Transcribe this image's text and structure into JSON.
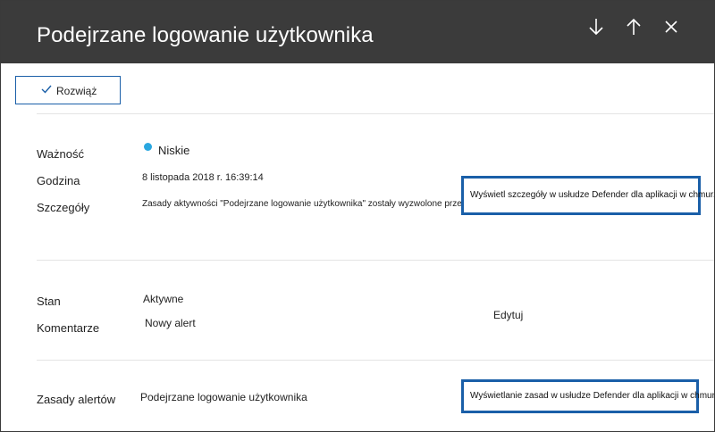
{
  "panel": {
    "title": "Podejrzane logowanie użytkownika",
    "resolve_label": "Rozwiąż"
  },
  "icons": {
    "down": "arrow-down-icon",
    "up": "arrow-up-icon",
    "close": "close-icon",
    "check": "checkmark-icon"
  },
  "details": {
    "severity_label": "Ważność",
    "severity_value": "Niskie",
    "severity_color": "#2aa7e0",
    "time_label": "Godzina",
    "time_value": "8 listopada 2018 r. 16:39:14",
    "details_label": "Szczegóły",
    "details_value": "Zasady aktywności \"Podejrzane logowanie użytkownika\" zostały wyzwolone przez",
    "details_link": "Wyświetl szczegóły w usłudze Defender dla aplikacji w chmurze"
  },
  "state": {
    "state_label": "Stan",
    "state_value": "Aktywne",
    "comments_label": "Komentarze",
    "comments_value": "Nowy alert",
    "edit_label": "Edytuj"
  },
  "policy": {
    "label": "Zasady alertów",
    "value": "Podejrzane logowanie użytkownika",
    "link": "Wyświetlanie zasad w usłudze Defender dla aplikacji w chmurze"
  },
  "colors": {
    "header_bg": "#3b3b3b",
    "accent": "#1a5fa8"
  }
}
